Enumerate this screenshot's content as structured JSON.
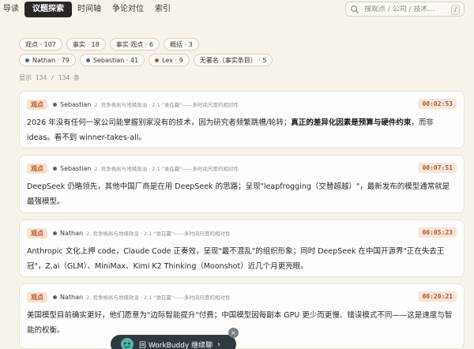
{
  "nav": {
    "tabs": [
      {
        "label": "导读",
        "active": false
      },
      {
        "label": "议题探索",
        "active": true
      },
      {
        "label": "时间轴",
        "active": false
      },
      {
        "label": "争论对位",
        "active": false
      },
      {
        "label": "索引",
        "active": false
      }
    ],
    "search_placeholder": "搜观点 / 公司 / 技术…",
    "search_shortcut": "/"
  },
  "filters": {
    "types": [
      {
        "label": "观点 · 107"
      },
      {
        "label": "事实 · 18"
      },
      {
        "label": "事实·观点 · 6"
      },
      {
        "label": "概括 · 3"
      }
    ],
    "authors": [
      {
        "label": "Nathan · 79",
        "color": "#3f6f7c"
      },
      {
        "label": "Sebastian · 41",
        "color": "#3f6f7c"
      },
      {
        "label": "Lex · 9",
        "color": "#a8553a"
      },
      {
        "label": "无署名（事实条目） · 5",
        "color": null
      }
    ],
    "count_text": "显示 134 / 134 条"
  },
  "cards": [
    {
      "badge": "观点",
      "author": "Sebastian",
      "author_color": "#3f6f7c",
      "path": "2. 竞争格局与地缘政治 · 2.1 \"谁在赢\"——多时间尺度的相对性",
      "time": "00:02:53",
      "text_before": "2026 年没有任何一家公司能掌握别家没有的技术，因为研究者频繁跳槽/轮转；",
      "text_bold": "真正的差异化因素是预算与硬件约束",
      "text_after": "，而非 ideas。看不到 winner-takes-all。"
    },
    {
      "badge": "观点",
      "author": "Sebastian",
      "author_color": "#3f6f7c",
      "path": "2. 竞争格局与地缘政治 · 2.1 \"谁在赢\"——多时间尺度的相对性",
      "time": "00:07:51",
      "text_before": "DeepSeek 仍略领先，其他中国厂商是在用 DeepSeek 的思路；呈现\"leapfrogging（交替超越）\"，最新发布的模型通常就是最强模型。",
      "text_bold": "",
      "text_after": ""
    },
    {
      "badge": "观点",
      "author": "Nathan",
      "author_color": "#3f6f7c",
      "path": "2. 竞争格局与地缘政治 · 2.1 \"谁在赢\"——多时间尺度的相对性",
      "time": "00:05:23",
      "text_before": "Anthropic 文化上押 code，Claude Code 正奏效，呈现\"最不混乱\"的组织形象；同时 DeepSeek 在中国开源界\"正在失去王冠\"，Z.ai（GLM）、MiniMax、Kimi K2 Thinking（Moonshot）近几个月更亮眼。",
      "text_bold": "",
      "text_after": ""
    },
    {
      "badge": "观点",
      "author": "Nathan",
      "author_color": "#3f6f7c",
      "path": "2. 竞争格局与地缘政治 · 2.1 \"谁在赢\"——多时间尺度的相对性",
      "time": "00:20:21",
      "text_before": "美国模型目前确实更好，他们愿意为\"边际智能提升\"付费；中国模型因每副本 GPU 更少而更慢、错误模式不同——这是速度与智能的权衡。",
      "text_bold": "",
      "text_after": ""
    }
  ],
  "floating": {
    "label": "回 WorkBuddy 继续聊",
    "chevron": "›",
    "close": "×"
  }
}
